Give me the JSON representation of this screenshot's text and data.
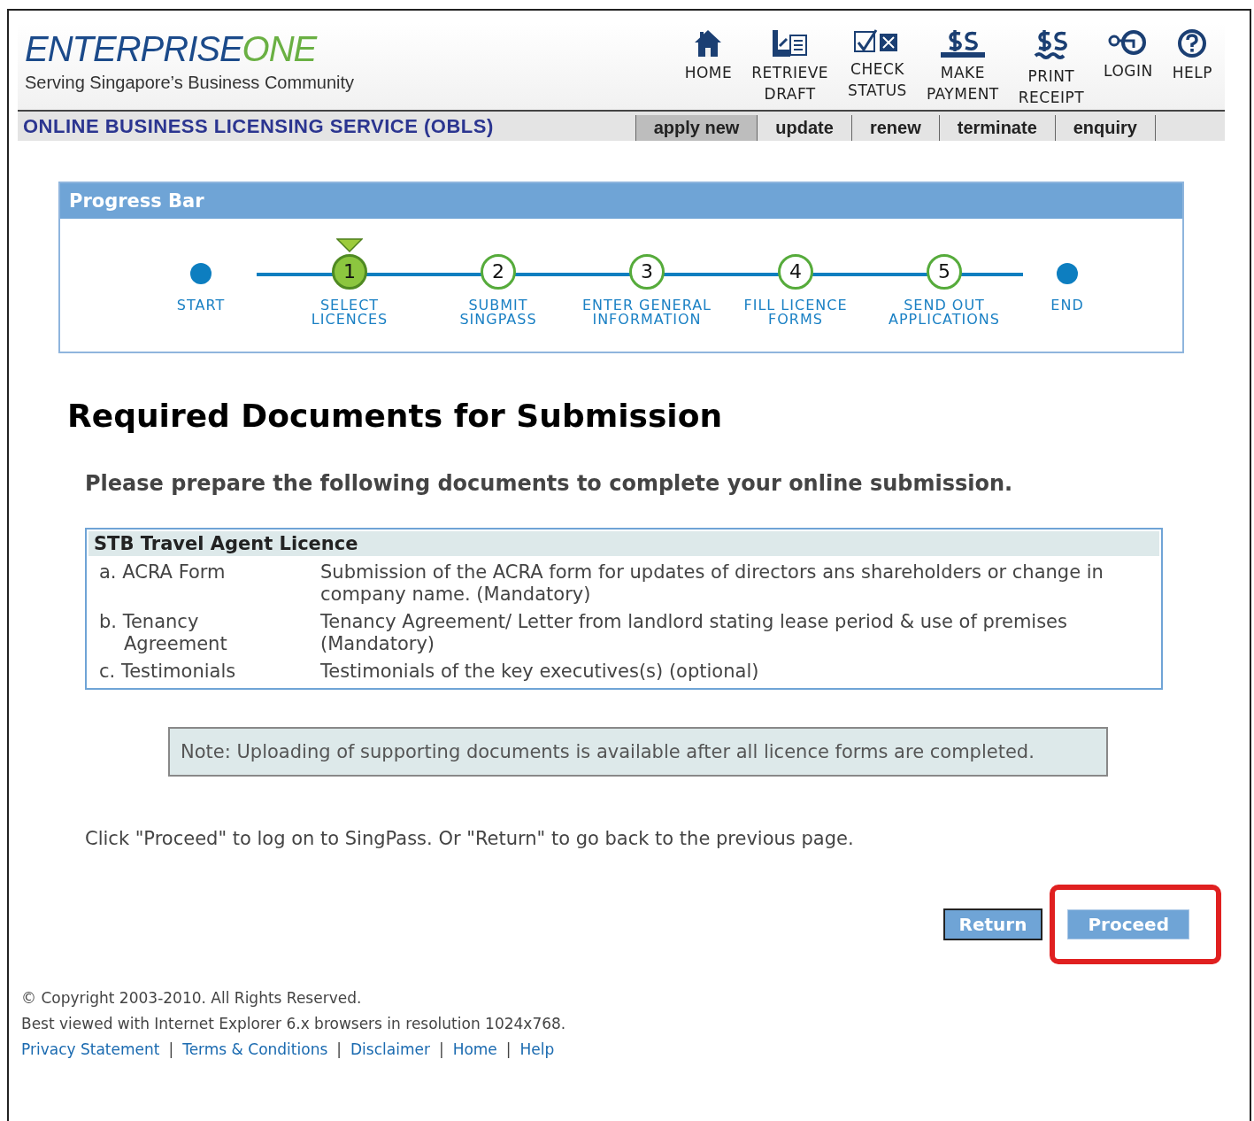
{
  "header": {
    "logo_main": "ENTERPRISE",
    "logo_accent": "ONE",
    "tagline": "Serving Singapore’s Business Community",
    "service_title": "ONLINE BUSINESS LICENSING SERVICE (OBLS)",
    "nav": [
      {
        "kind": "home",
        "lines": [
          "HOME"
        ]
      },
      {
        "kind": "retrieve",
        "lines": [
          "RETRIEVE",
          "DRAFT"
        ]
      },
      {
        "kind": "check",
        "lines": [
          "CHECK",
          "STATUS"
        ]
      },
      {
        "kind": "payment",
        "lines": [
          "MAKE",
          "PAYMENT"
        ]
      },
      {
        "kind": "receipt",
        "lines": [
          "PRINT",
          "RECEIPT"
        ]
      },
      {
        "kind": "login",
        "lines": [
          "LOGIN"
        ]
      },
      {
        "kind": "help",
        "lines": [
          "HELP"
        ]
      }
    ],
    "tabs": [
      {
        "label": "apply new",
        "selected": true
      },
      {
        "label": "update",
        "selected": false
      },
      {
        "label": "renew",
        "selected": false
      },
      {
        "label": "terminate",
        "selected": false
      },
      {
        "label": "enquiry",
        "selected": false
      }
    ]
  },
  "progress": {
    "title": "Progress Bar",
    "steps": [
      {
        "kind": "dot",
        "lines": [
          "START"
        ],
        "selected": false
      },
      {
        "kind": "number",
        "number": "1",
        "lines": [
          "SELECT",
          "LICENCES"
        ],
        "selected": true
      },
      {
        "kind": "number",
        "number": "2",
        "lines": [
          "SUBMIT",
          "SINGPASS"
        ],
        "selected": false
      },
      {
        "kind": "number",
        "number": "3",
        "lines": [
          "ENTER GENERAL",
          "INFORMATION"
        ],
        "selected": false
      },
      {
        "kind": "number",
        "number": "4",
        "lines": [
          "FILL LICENCE",
          "FORMS"
        ],
        "selected": false
      },
      {
        "kind": "number",
        "number": "5",
        "lines": [
          "SEND OUT",
          "APPLICATIONS"
        ],
        "selected": false
      },
      {
        "kind": "dot",
        "lines": [
          "END"
        ],
        "selected": false
      }
    ]
  },
  "heading": "Required Documents for Submission",
  "intro": "Please prepare the following documents to complete your online submission.",
  "documents": {
    "title": "STB Travel Agent Licence",
    "rows": [
      {
        "name": "a. ACRA Form",
        "description": "Submission of the ACRA form for updates of directors ans shareholders or change in company name. (Mandatory)"
      },
      {
        "name": "b. Tenancy Agreement",
        "description": "Tenancy Agreement/ Letter from landlord stating lease period & use of premises (Mandatory)"
      },
      {
        "name": "c. Testimonials",
        "description": "Testimonials of the key executives(s) (optional)"
      }
    ]
  },
  "note": "Note: Uploading of supporting documents is available after all licence forms are completed.",
  "instruction": "Click \"Proceed\" to log on to SingPass. Or \"Return\" to go back to the previous page.",
  "buttons": [
    {
      "label": "Return",
      "highlighted": false
    },
    {
      "label": "Proceed",
      "highlighted": true
    }
  ],
  "footer": {
    "copyright": "© Copyright 2003-2010. All Rights Reserved.",
    "browser_note": "Best viewed with Internet Explorer 6.x browsers in resolution 1024x768.",
    "links": [
      "Privacy Statement",
      "Terms & Conditions",
      "Disclaimer",
      "Home",
      "Help"
    ],
    "separator": "|"
  }
}
